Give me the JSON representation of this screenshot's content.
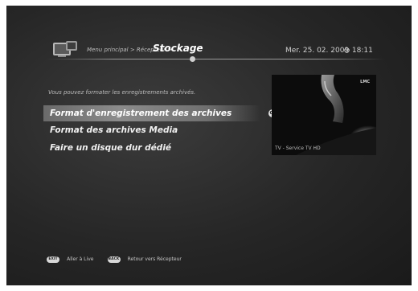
{
  "header": {
    "breadcrumb_path": "Menu principal > Récepteur >",
    "current_section": "Stockage",
    "date": "Mer. 25. 02. 2009",
    "time": "18:11"
  },
  "main": {
    "description": "Vous pouvez formater les enregistrements archivés.",
    "menu_items": [
      {
        "label": "Format d'enregistrement des archives",
        "selected": true
      },
      {
        "label": "Format des archives Media",
        "selected": false
      },
      {
        "label": "Faire un disque dur dédié",
        "selected": false
      }
    ],
    "ok_badge": "OK"
  },
  "preview": {
    "caption": "TV - Service TV HD",
    "channel_logo": "LMC"
  },
  "footer": {
    "keys": [
      {
        "key": "EXIT",
        "label": "Aller à Live"
      },
      {
        "key": "BACK",
        "label": "Retour vers Récepteur"
      }
    ]
  },
  "colors": {
    "background": "#262626",
    "highlight": "#8c8c8c",
    "text": "#f0f0f0"
  },
  "icons": [
    "receiver-icon",
    "clock-icon"
  ]
}
